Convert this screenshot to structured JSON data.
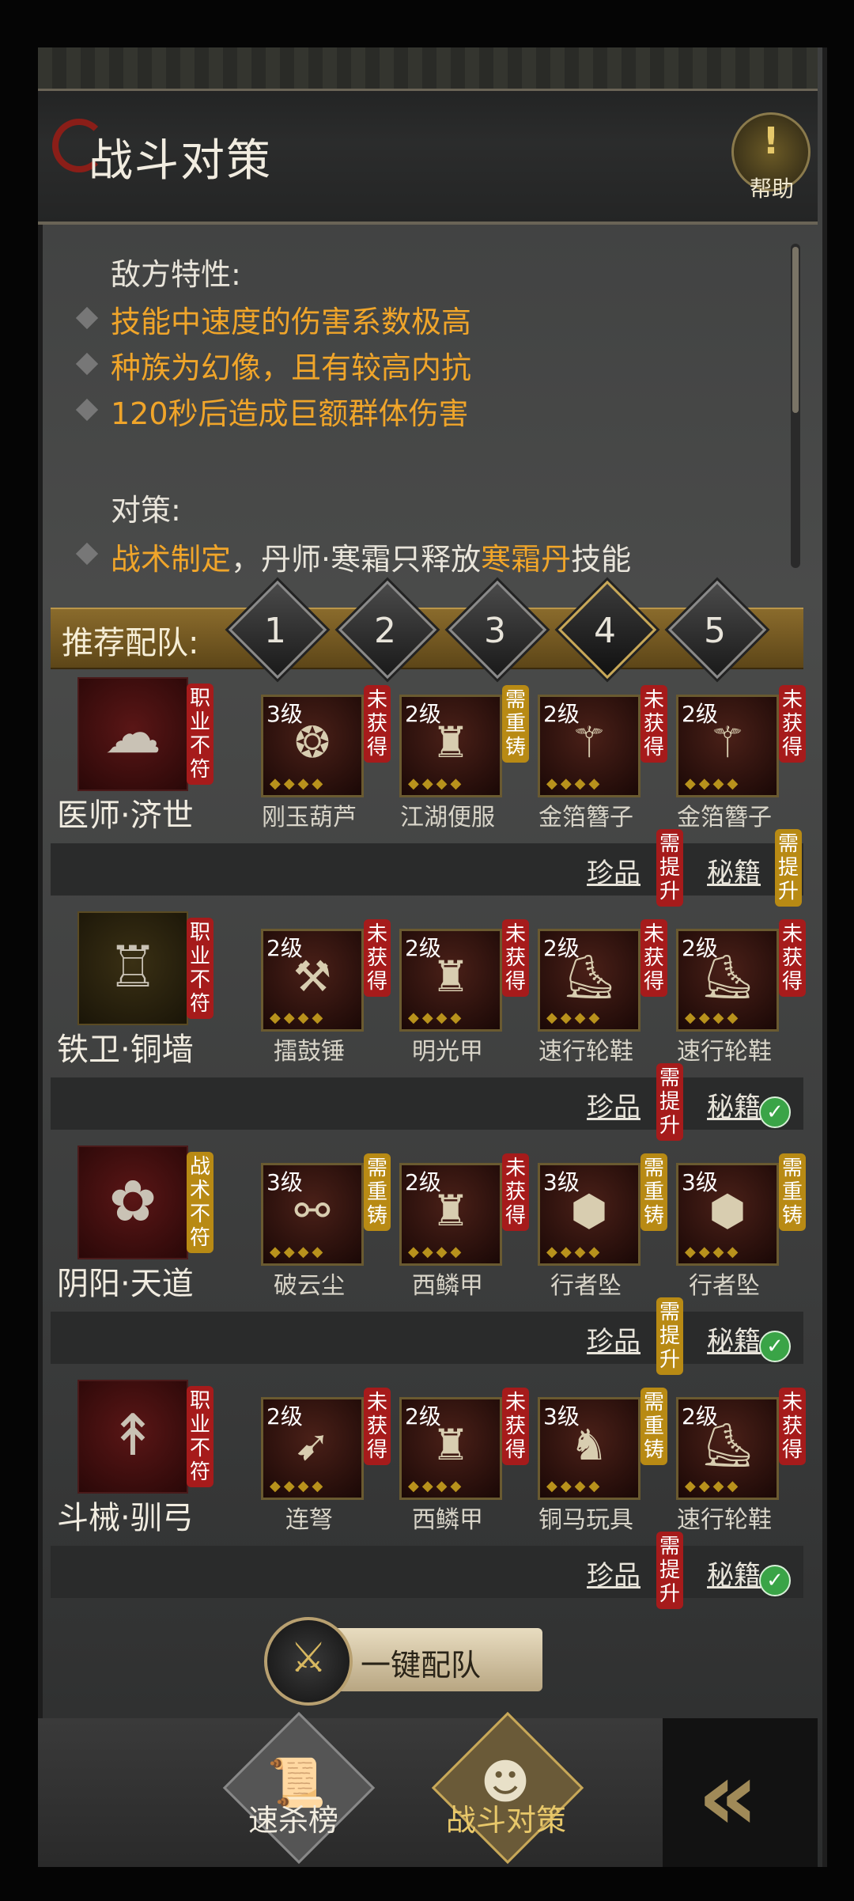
{
  "header": {
    "title": "战斗对策",
    "help_label": "帮助"
  },
  "enemy": {
    "heading": "敌方特性:",
    "traits": [
      "技能中速度的伤害系数极高",
      "种族为幻像，且有较高内抗",
      "120秒后造成巨额群体伤害"
    ]
  },
  "strategy": {
    "heading": "对策:",
    "parts": [
      "战术制定",
      "，丹师·寒霜只释放",
      "寒霜丹",
      "技能"
    ]
  },
  "team": {
    "label": "推荐配队:",
    "slots": [
      "1",
      "2",
      "3",
      "4",
      "5"
    ],
    "selected": "4"
  },
  "rows": [
    {
      "name": "医师·济世",
      "tag": "职业不符",
      "tag_type": "red",
      "icon": "healer-emblem-icon",
      "glyph": "☁",
      "items": [
        {
          "level": "3级",
          "name": "刚玉葫芦",
          "status": "未获得",
          "status_type": "red",
          "glyph": "❂"
        },
        {
          "level": "2级",
          "name": "江湖便服",
          "status": "需重铸",
          "status_type": "yel",
          "glyph": "♜"
        },
        {
          "level": "2级",
          "name": "金箔簪子",
          "status": "未获得",
          "status_type": "red",
          "glyph": "⚚"
        },
        {
          "level": "2级",
          "name": "金箔簪子",
          "status": "未获得",
          "status_type": "red",
          "glyph": "⚚"
        }
      ],
      "treasure": "珍品",
      "treasure_status": "需提升",
      "treasure_status_type": "red",
      "manual": "秘籍",
      "manual_status": "需提升",
      "manual_status_type": "yel",
      "manual_done": false
    },
    {
      "name": "铁卫·铜墙",
      "tag": "职业不符",
      "tag_type": "red",
      "icon": "guard-emblem-icon",
      "glyph": "♖",
      "items": [
        {
          "level": "2级",
          "name": "擂鼓锤",
          "status": "未获得",
          "status_type": "red",
          "glyph": "⚒"
        },
        {
          "level": "2级",
          "name": "明光甲",
          "status": "未获得",
          "status_type": "red",
          "glyph": "♜"
        },
        {
          "level": "2级",
          "name": "速行轮鞋",
          "status": "未获得",
          "status_type": "red",
          "glyph": "⛸"
        },
        {
          "level": "2级",
          "name": "速行轮鞋",
          "status": "未获得",
          "status_type": "red",
          "glyph": "⛸"
        }
      ],
      "treasure": "珍品",
      "treasure_status": "需提升",
      "treasure_status_type": "red",
      "manual": "秘籍",
      "manual_status": "",
      "manual_status_type": "",
      "manual_done": true
    },
    {
      "name": "阴阳·天道",
      "tag": "战术不符",
      "tag_type": "yel",
      "icon": "yinyang-emblem-icon",
      "glyph": "✿",
      "items": [
        {
          "level": "3级",
          "name": "破云尘",
          "status": "需重铸",
          "status_type": "yel",
          "glyph": "⚯"
        },
        {
          "level": "2级",
          "name": "西鳞甲",
          "status": "未获得",
          "status_type": "red",
          "glyph": "♜"
        },
        {
          "level": "3级",
          "name": "行者坠",
          "status": "需重铸",
          "status_type": "yel",
          "glyph": "⬢"
        },
        {
          "level": "3级",
          "name": "行者坠",
          "status": "需重铸",
          "status_type": "yel",
          "glyph": "⬢"
        }
      ],
      "treasure": "珍品",
      "treasure_status": "需提升",
      "treasure_status_type": "yel",
      "manual": "秘籍",
      "manual_status": "",
      "manual_status_type": "",
      "manual_done": true
    },
    {
      "name": "斗械·驯弓",
      "tag": "职业不符",
      "tag_type": "red",
      "icon": "archer-emblem-icon",
      "glyph": "↟",
      "items": [
        {
          "level": "2级",
          "name": "连弩",
          "status": "未获得",
          "status_type": "red",
          "glyph": "➹"
        },
        {
          "level": "2级",
          "name": "西鳞甲",
          "status": "未获得",
          "status_type": "red",
          "glyph": "♜"
        },
        {
          "level": "3级",
          "name": "铜马玩具",
          "status": "需重铸",
          "status_type": "yel",
          "glyph": "♞"
        },
        {
          "level": "2级",
          "name": "速行轮鞋",
          "status": "未获得",
          "status_type": "red",
          "glyph": "⛸"
        }
      ],
      "treasure": "珍品",
      "treasure_status": "需提升",
      "treasure_status_type": "red",
      "manual": "秘籍",
      "manual_status": "",
      "manual_status_type": "",
      "manual_done": true
    }
  ],
  "actions": {
    "one_key": "一键配队"
  },
  "nav": {
    "speed_rank": "速杀榜",
    "battle_strategy": "战斗对策"
  },
  "colors": {
    "accent_orange": "#f0a52a",
    "tag_red": "#a61b1b",
    "tag_yellow": "#b88a14",
    "check_green": "#3aa447"
  }
}
